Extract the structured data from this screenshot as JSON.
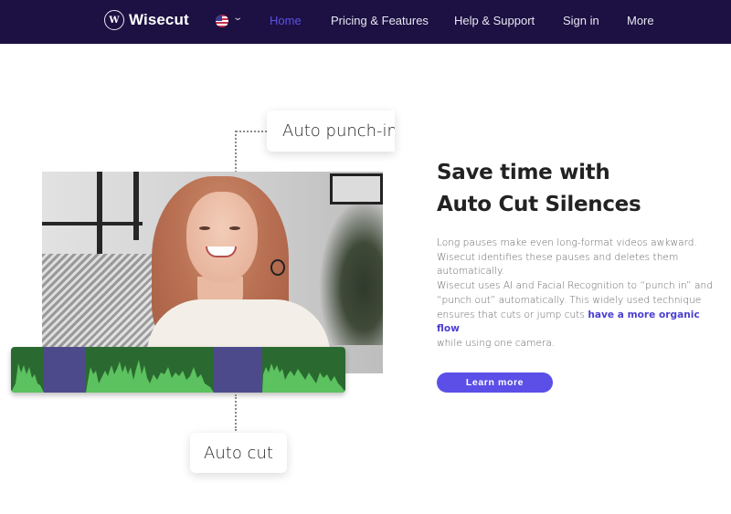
{
  "nav": {
    "logo_text": "Wisecut",
    "logo_mark": "W",
    "language_icon": "us-flag-icon",
    "items": [
      {
        "label": "Home",
        "active": true
      },
      {
        "label": "Pricing & Features",
        "active": false
      },
      {
        "label": "Help & Support",
        "active": false
      },
      {
        "label": "Sign in",
        "active": false
      },
      {
        "label": "More",
        "active": false
      }
    ]
  },
  "illustration": {
    "tag_punch_in": "Auto punch-in",
    "tag_auto_cut": "Auto cut"
  },
  "feature": {
    "heading_line1": "Save time with",
    "heading_line2": "Auto Cut Silences",
    "para1_line1": "Long pauses make even long-format videos awkward.",
    "para1_line2": "Wisecut identifies these pauses and deletes them",
    "para1_line3": "automatically.",
    "para2_line1": "Wisecut uses AI and Facial Recognition to “punch in” and",
    "para2_line2": "“punch out” automatically. This widely used technique",
    "para2_line3_prefix": "ensures that cuts or jump cuts ",
    "para2_link": "have a more organic flow",
    "para2_line4": "while using one camera.",
    "button_label": "Learn more"
  },
  "colors": {
    "nav_bg": "#1c1142",
    "accent": "#5b4fe8",
    "waveform_bg": "#2a6a30",
    "waveform_fill": "#5cc15f",
    "cut_region": "#4d4a8c"
  }
}
